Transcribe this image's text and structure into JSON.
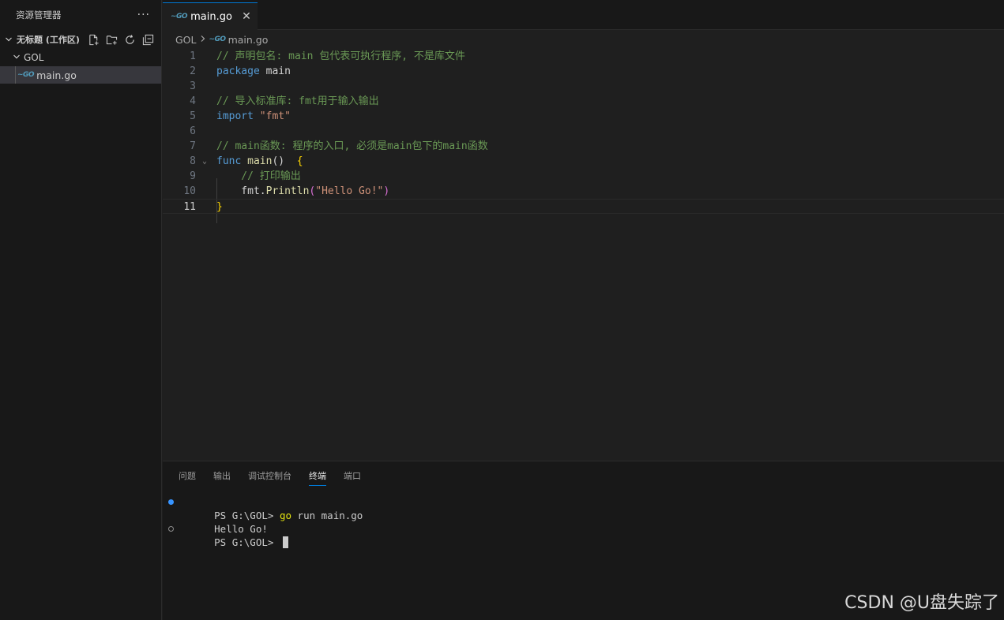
{
  "sidebar": {
    "title": "资源管理器",
    "more_label": "···",
    "workspace_label": "无标题 (工作区)",
    "folder_label": "GOL",
    "file_label": "main.go"
  },
  "editor": {
    "tab_label": "main.go",
    "tab_close": "✕",
    "breadcrumb": {
      "folder": "GOL",
      "file": "main.go"
    },
    "active_line": 11,
    "lines": [
      {
        "n": "1",
        "parts": [
          {
            "t": "// 声明包名: main 包代表可执行程序, 不是库文件",
            "c": "c-comment"
          }
        ]
      },
      {
        "n": "2",
        "parts": [
          {
            "t": "package",
            "c": "c-kw"
          },
          {
            "t": " main",
            "c": "c-pkg"
          }
        ]
      },
      {
        "n": "3",
        "parts": []
      },
      {
        "n": "4",
        "parts": [
          {
            "t": "// 导入标准库: fmt用于输入输出",
            "c": "c-comment"
          }
        ]
      },
      {
        "n": "5",
        "parts": [
          {
            "t": "import",
            "c": "c-kw"
          },
          {
            "t": " \"fmt\"",
            "c": "c-str"
          }
        ]
      },
      {
        "n": "6",
        "parts": []
      },
      {
        "n": "7",
        "parts": [
          {
            "t": "// main函数: 程序的入口, 必须是main包下的main函数",
            "c": "c-comment"
          }
        ]
      },
      {
        "n": "8",
        "parts": [
          {
            "t": "func",
            "c": "c-kw"
          },
          {
            "t": " main",
            "c": "c-fn"
          },
          {
            "t": "()",
            "c": "c-pkg"
          },
          {
            "t": "  {",
            "c": "c-brace"
          }
        ]
      },
      {
        "n": "9",
        "parts": [
          {
            "t": "    // 打印输出",
            "c": "c-comment"
          }
        ]
      },
      {
        "n": "10",
        "parts": [
          {
            "t": "    fmt.",
            "c": "c-pkg"
          },
          {
            "t": "Println",
            "c": "c-fn"
          },
          {
            "t": "(",
            "c": "c-paren2"
          },
          {
            "t": "\"Hello Go!\"",
            "c": "c-str"
          },
          {
            "t": ")",
            "c": "c-paren2"
          }
        ]
      },
      {
        "n": "11",
        "parts": [
          {
            "t": "}",
            "c": "c-brace"
          }
        ]
      }
    ]
  },
  "panel": {
    "tabs": [
      "问题",
      "输出",
      "调试控制台",
      "终端",
      "端口"
    ],
    "active_tab": "终端",
    "terminal": {
      "prompt": "PS G:\\GOL> ",
      "command_go": "go",
      "command_rest": " run main.go",
      "output": "Hello Go!"
    }
  },
  "watermark": "CSDN @U盘失踪了",
  "colors": {
    "accent": "#0078d4",
    "go_icon": "#519aba"
  }
}
